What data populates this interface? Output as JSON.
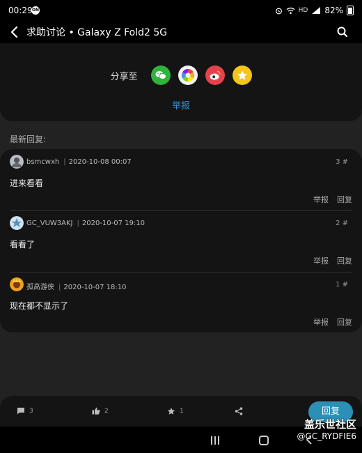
{
  "status": {
    "time": "00:29",
    "circle_icon_text": "ON",
    "network": "HD",
    "battery": "82%"
  },
  "header": {
    "title": "求助讨论 • Galaxy Z Fold2 5G"
  },
  "share": {
    "label": "分享至",
    "report": "举报",
    "targets": [
      {
        "name": "wechat",
        "color": "#2fb33b"
      },
      {
        "name": "moments",
        "color": "#f2f2f2"
      },
      {
        "name": "weibo",
        "color": "#e5424d"
      },
      {
        "name": "favorite",
        "color": "#f5c518"
      }
    ]
  },
  "latest_label": "最新回复:",
  "replies": [
    {
      "user": "bsmcwxh",
      "time": "2020-10-08 00:07",
      "floor": "3 #",
      "content": "进来看看",
      "report": "举报",
      "reply": "回复"
    },
    {
      "user": "GC_VUW3AKJ",
      "time": "2020-10-07 19:10",
      "floor": "2 #",
      "content": "看看了",
      "report": "举报",
      "reply": "回复"
    },
    {
      "user": "孤高游侠",
      "time": "2020-10-07 18:10",
      "floor": "1 #",
      "content": "现在都不显示了",
      "report": "举报",
      "reply": "回复"
    }
  ],
  "bottom": {
    "comments": "3",
    "likes": "2",
    "favorites": "1",
    "reply_button": "回复"
  },
  "watermark": {
    "brand": "盖乐世社区",
    "handle": "@GC_RYDFIE6"
  },
  "colors": {
    "accent": "#2b8fb6",
    "report_link": "#3a8fd0",
    "background": "#222222",
    "card": "#141414"
  }
}
